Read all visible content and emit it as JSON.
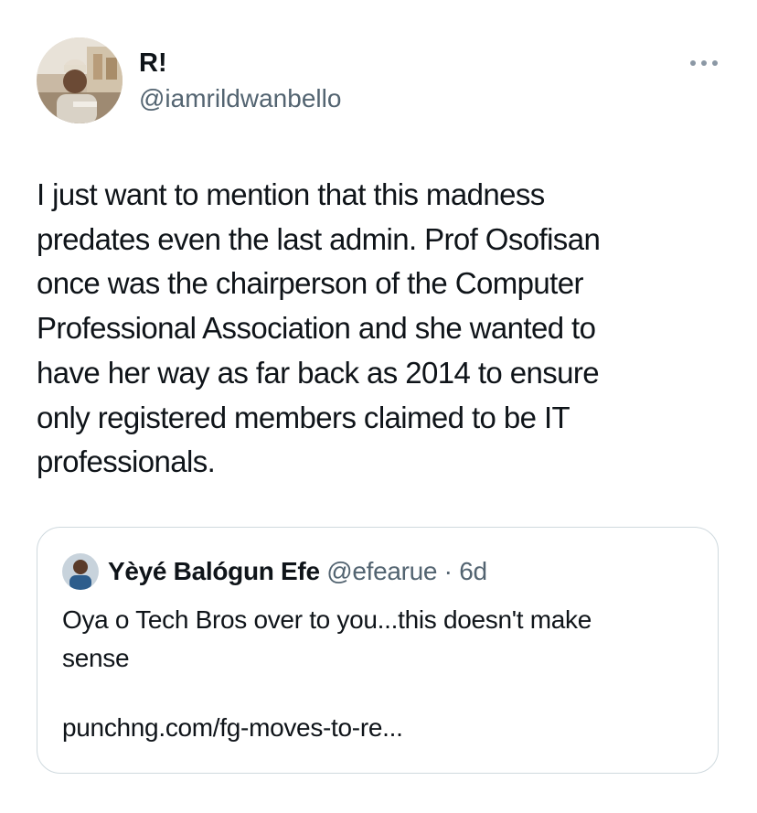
{
  "tweet": {
    "author_name": "R!",
    "author_handle": "@iamrildwanbello",
    "more_icon": "more-horizontal-icon",
    "text_lines": [
      "I just want to mention that this madness",
      "predates even the last admin. Prof Osofisan",
      "once was the chairperson of the Computer",
      "Professional Association and she wanted to",
      "have her way as far back as 2014 to ensure",
      "only registered members claimed to be IT",
      "professionals."
    ]
  },
  "quoted_tweet": {
    "author_name": "Yèyé Balógun Efe",
    "author_handle": "@efearue",
    "separator": "·",
    "time": "6d",
    "text_lines": [
      "Oya o Tech Bros over to you...this doesn't make",
      "sense"
    ],
    "link": "punchng.com/fg-moves-to-re..."
  },
  "colors": {
    "text": "#0f1419",
    "secondary": "#536471",
    "border": "#cfd9de"
  }
}
